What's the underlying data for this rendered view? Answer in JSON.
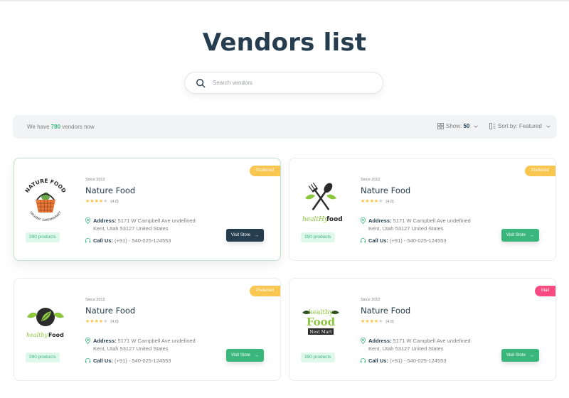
{
  "page": {
    "title": "Vendors list",
    "search_placeholder": "Search vendors"
  },
  "filter": {
    "count_prefix": "We have",
    "count": "780",
    "count_suffix": "vendors now",
    "show_label": "Show:",
    "show_value": "50",
    "sort_label": "Sort by:",
    "sort_value": "Featured"
  },
  "colors": {
    "brand": "#3bb77e",
    "heading": "#253d4e",
    "preferred_badge": "#f9c74f",
    "mall_badge": "#f74b81",
    "dark_button": "#253d4e"
  },
  "vendors": [
    {
      "logo": "nature-food-basket-logo",
      "badge": "Preferred",
      "since": "Since 2012",
      "name": "Nature Food",
      "rating": "(4.0)",
      "stars": 4,
      "address_label": "Address:",
      "address_line1": "5171 W Campbell Ave undefined",
      "address_line2": "Kent, Utah 53127 United States",
      "phone_label": "Call Us:",
      "phone": "(+91) - 540-025-124553",
      "products": "390 products",
      "button": "Visit Store"
    },
    {
      "logo": "healthy-food-spoon-fork-logo",
      "badge": "Preferred",
      "since": "Since 2012",
      "name": "Nature Food",
      "rating": "(4.0)",
      "stars": 4,
      "address_label": "Address:",
      "address_line1": "5171 W Campbell Ave undefined",
      "address_line2": "Kent, Utah 53127 United States",
      "phone_label": "Call Us:",
      "phone": "(+91) - 540-025-124553",
      "products": "390 products",
      "button": "Visit Store"
    },
    {
      "logo": "healthy-food-leaf-circle-logo",
      "badge": "Preferred",
      "since": "Since 2012",
      "name": "Nature Food",
      "rating": "(4.0)",
      "stars": 4,
      "address_label": "Address:",
      "address_line1": "5171 W Campbell Ave undefined",
      "address_line2": "Kent, Utah 53127 United States",
      "phone_label": "Call Us:",
      "phone": "(+91) - 540-025-124553",
      "products": "390 products",
      "button": "Visit Store"
    },
    {
      "logo": "healthy-food-nest-mart-logo",
      "badge": "Mall",
      "since": "Since 2012",
      "name": "Nature Food",
      "rating": "(4.0)",
      "stars": 4,
      "address_label": "Address:",
      "address_line1": "5171 W Campbell Ave undefined",
      "address_line2": "Kent, Utah 53127 United States",
      "phone_label": "Call Us:",
      "phone": "(+91) - 540-025-124553",
      "products": "390 products",
      "button": "Visit Store"
    }
  ],
  "logos": {
    "nature_food_top": "NATURE FOOD",
    "nature_food_bottom": "ORGANIC SUPERMARKET",
    "healthy_food_a": "healtHy",
    "healthy_food_b": "food",
    "healthy_food_c": "healthy",
    "healthy_food_d": "Food",
    "healthy_food_e": "healthy",
    "healthy_food_f": "Food",
    "nest_mart": "Nest Mart"
  }
}
